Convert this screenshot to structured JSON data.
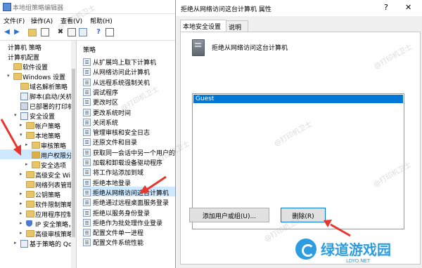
{
  "gpedit": {
    "title": "本地组策略编辑器",
    "menu": [
      "文件(F)",
      "操作(A)",
      "查看(V)",
      "帮助(H)"
    ],
    "tree": [
      {
        "label": "计算机 策略",
        "level": 0,
        "icon": "none"
      },
      {
        "label": "计算机配置",
        "level": 0,
        "icon": "none"
      },
      {
        "label": "软件设置",
        "level": 1,
        "icon": "folder"
      },
      {
        "label": "Windows 设置",
        "level": 1,
        "icon": "folder",
        "twisty": "v"
      },
      {
        "label": "域名解析策略",
        "level": 2,
        "icon": "folder"
      },
      {
        "label": "脚本(启动/关机)",
        "level": 2,
        "icon": "policy"
      },
      {
        "label": "已部署的打印机",
        "level": 2,
        "icon": "printer"
      },
      {
        "label": "安全设置",
        "level": 2,
        "icon": "policy",
        "twisty": "v"
      },
      {
        "label": "帐户策略",
        "level": 3,
        "icon": "folder",
        "twisty": ">"
      },
      {
        "label": "本地策略",
        "level": 3,
        "icon": "folder",
        "twisty": "v"
      },
      {
        "label": "审核策略",
        "level": 4,
        "icon": "folder",
        "twisty": ">"
      },
      {
        "label": "用户权限分配",
        "level": 4,
        "icon": "folder-dark",
        "selected": true
      },
      {
        "label": "安全选项",
        "level": 4,
        "icon": "folder",
        "twisty": ">"
      },
      {
        "label": "高级安全 Windows",
        "level": 3,
        "icon": "folder",
        "twisty": ">"
      },
      {
        "label": "网络列表管理器",
        "level": 3,
        "icon": "folder"
      },
      {
        "label": "公钥策略",
        "level": 3,
        "icon": "folder",
        "twisty": ">"
      },
      {
        "label": "软件限制策略",
        "level": 3,
        "icon": "folder",
        "twisty": ">"
      },
      {
        "label": "应用程序控制策略",
        "level": 3,
        "icon": "folder",
        "twisty": ">"
      },
      {
        "label": "IP 安全策略，在",
        "level": 3,
        "icon": "shield",
        "twisty": ">"
      },
      {
        "label": "高级审核策略配置",
        "level": 3,
        "icon": "folder",
        "twisty": ">"
      },
      {
        "label": "基于策略的 QoS",
        "level": 2,
        "icon": "chart",
        "twisty": ">"
      }
    ],
    "list_header": "策略",
    "policies": [
      "从扩展坞上取下计算机",
      "从网络访问此计算机",
      "从远程系统强制关机",
      "调试程序",
      "更改时区",
      "更改系统时间",
      "关闭系统",
      "管理审核和安全日志",
      "还原文件和目录",
      "获取同一会话中另一个用户的模拟令牌",
      "加载和卸载设备驱动程序",
      "将工作站添加到域",
      "拒绝本地登录",
      "拒绝从网络访问这台计算机",
      "拒绝通过远程桌面服务登录",
      "拒绝以服务身份登录",
      "拒绝作为批处理作业登录",
      "配置文件单一进程",
      "配置文件系统性能"
    ],
    "selected_policy_index": 13
  },
  "dialog": {
    "title": "拒绝从网络访问这台计算机 属性",
    "help_label": "?",
    "close_label": "✕",
    "tabs": [
      "本地安全设置",
      "说明"
    ],
    "active_tab": 0,
    "policy_name": "拒绝从网络访问这台计算机",
    "accounts": [
      "Guest"
    ],
    "add_button": "添加用户或组(U)...",
    "remove_button": "删除(R)"
  },
  "watermark": "@打印机卫士",
  "logo": {
    "text": "绿道游戏园",
    "sub": "LDYO.NET"
  },
  "colors": {
    "selection": "#0078d7",
    "tree_selection": "#cde8ff",
    "arrow": "#e8362e",
    "logo": "#2d9ce0"
  }
}
